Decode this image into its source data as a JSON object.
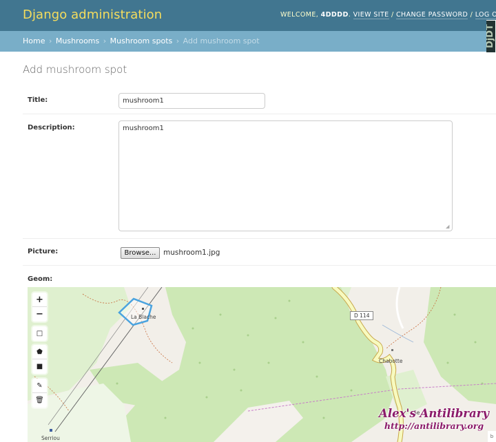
{
  "header": {
    "brand": "Django administration",
    "welcome": "WELCOME,",
    "username": "4DDDD",
    "view_site": "VIEW SITE",
    "change_password": "CHANGE PASSWORD",
    "logout": "LOG O",
    "separator": "/"
  },
  "debug_toolbar": {
    "handle": "DjDT"
  },
  "breadcrumbs": {
    "home": "Home",
    "app": "Mushrooms",
    "model": "Mushroom spots",
    "current": "Add mushroom spot",
    "arrow": "›"
  },
  "page_title": "Add mushroom spot",
  "form": {
    "title": {
      "label": "Title:",
      "value": "mushroom1"
    },
    "description": {
      "label": "Description:",
      "value": "mushroom1"
    },
    "picture": {
      "label": "Picture:",
      "button": "Browse...",
      "filename": "mushroom1.jpg"
    },
    "geom": {
      "label": "Geom:"
    }
  },
  "map": {
    "controls": {
      "zoom_in": "+",
      "zoom_out": "−",
      "box": "□",
      "polygon": "⬟",
      "square": "■",
      "modify": "✎",
      "delete": "🗑"
    },
    "labels": {
      "la_blache": "La Blache",
      "road": "D 114",
      "chabotte": "Chabotte",
      "serriou": "Serriou",
      "se": "Se"
    },
    "edge": "b",
    "colors": {
      "forest": "#cde8b5",
      "forest_dark": "#b5d99c",
      "road": "#f7fabf",
      "road_border": "#c8a64a",
      "polygon": "#4aa3df"
    }
  },
  "watermark": {
    "title": "Alex's Antilibrary",
    "url": "http://antilibrary.org"
  }
}
